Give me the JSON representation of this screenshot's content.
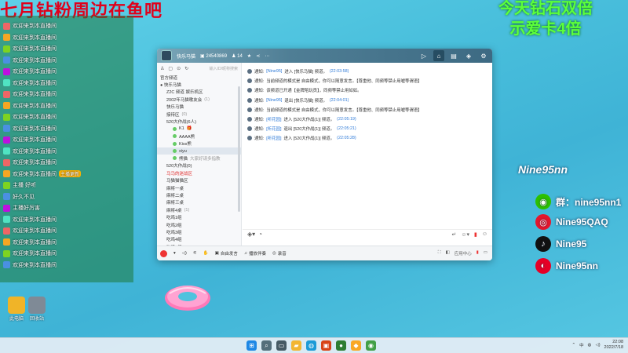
{
  "overlay": {
    "top_left_title": "七月钻粉周边在鱼吧",
    "top_right_title": "今天钻石双倍\n示爱卡4倍",
    "nine_title": "Nine95nn",
    "social": [
      {
        "icon": "wechat-icon",
        "label": "群：nine95nn1",
        "color": "#2dc100",
        "glyph": "◉"
      },
      {
        "icon": "weibo-icon",
        "label": "Nine95QAQ",
        "color": "#e6162d",
        "glyph": "◎"
      },
      {
        "icon": "tiktok-icon",
        "label": "Nine95",
        "color": "#111111",
        "glyph": "♪"
      },
      {
        "icon": "netease-music-icon",
        "label": "Nine95nn",
        "color": "#e60026",
        "glyph": "◐"
      }
    ]
  },
  "chat_overlay": {
    "lines": [
      {
        "name": "",
        "text": "欢迎来到本直播间"
      },
      {
        "name": "",
        "text": "欢迎来到本直播间"
      },
      {
        "name": "",
        "text": "欢迎来到本直播间"
      },
      {
        "name": "",
        "text": "欢迎来到本直播间"
      },
      {
        "name": "",
        "text": "欢迎来到本直播间"
      },
      {
        "name": "",
        "text": "欢迎来到本直播间"
      },
      {
        "name": "",
        "text": "欢迎来到本直播间"
      },
      {
        "name": "",
        "text": "欢迎来到本直播间"
      },
      {
        "name": "",
        "text": "欢迎来到本直播间"
      },
      {
        "name": "",
        "text": "欢迎来到本直播间"
      },
      {
        "name": "",
        "text": "欢迎来到本直播间"
      },
      {
        "name": "",
        "text": "欢迎来到本直播间"
      },
      {
        "name": "",
        "text": "欢迎来到本直播间"
      },
      {
        "name": "",
        "text": "欢迎来到本直播间"
      },
      {
        "name": "",
        "text": "主播 好听"
      },
      {
        "name": "",
        "text": "好久不见"
      },
      {
        "name": "",
        "text": "主播好厉害"
      },
      {
        "name": "",
        "text": "欢迎来到本直播间"
      },
      {
        "name": "",
        "text": "欢迎来到本直播间"
      },
      {
        "name": "",
        "text": "欢迎来到本直播间"
      },
      {
        "name": "",
        "text": "欢迎来到本直播间"
      },
      {
        "name": "",
        "text": "欢迎来到本直播间"
      }
    ],
    "gift_badge": "主播更新"
  },
  "desktop_icons": [
    {
      "label": "此电脑",
      "color": "#f0b428"
    },
    {
      "label": "回收站",
      "color": "#7f8a96"
    }
  ],
  "window": {
    "title": "快乐马猫",
    "room_id": "24540869",
    "online": "14",
    "toolbar_icons": [
      "video-icon",
      "home-icon",
      "list-icon",
      "gamepad-icon",
      "settings-icon"
    ],
    "sidebar": {
      "search_placeholder": "输入ID/昵称搜索",
      "items": [
        {
          "text": "官方频道",
          "level": 0,
          "cls": ""
        },
        {
          "text": "● 快乐马猫",
          "level": 0,
          "cls": ""
        },
        {
          "text": "Z2C 频道 娱乐机区",
          "level": 1,
          "cls": ""
        },
        {
          "text": "2002年马猫歌友会",
          "level": 1,
          "cls": "",
          "count": "(1)"
        },
        {
          "text": "快乐马猫",
          "level": 1,
          "cls": ""
        },
        {
          "text": "接待区",
          "level": 1,
          "cls": "",
          "count": "(0)"
        },
        {
          "text": "520大作战(6人)",
          "level": 1,
          "cls": ""
        },
        {
          "text": "K1",
          "level": 2,
          "cls": "",
          "badge": "🎁"
        },
        {
          "text": "AAAA熊",
          "level": 2,
          "cls": ""
        },
        {
          "text": "Kiss熊",
          "level": 2,
          "cls": ""
        },
        {
          "text": "xiyu",
          "level": 2,
          "cls": "sel"
        },
        {
          "text": "熊猫",
          "level": 2,
          "cls": "",
          "note": "大家好请多指教"
        },
        {
          "text": "520大作战(0)",
          "level": 1,
          "cls": ""
        },
        {
          "text": "马马的迷战区",
          "level": 1,
          "cls": "red"
        },
        {
          "text": "马猫猫猫区",
          "level": 1,
          "cls": ""
        },
        {
          "text": "麻将一桌",
          "level": 1,
          "cls": ""
        },
        {
          "text": "麻将二桌",
          "level": 1,
          "cls": ""
        },
        {
          "text": "麻将三桌",
          "level": 1,
          "cls": ""
        },
        {
          "text": "麻将4桌",
          "level": 1,
          "cls": "",
          "count": "(1)"
        },
        {
          "text": "吃鸡1组",
          "level": 1,
          "cls": ""
        },
        {
          "text": "吃鸡2组",
          "level": 1,
          "cls": ""
        },
        {
          "text": "吃鸡3组",
          "level": 1,
          "cls": ""
        },
        {
          "text": "吃鸡4组",
          "level": 1,
          "cls": ""
        },
        {
          "text": "吃鸡5组",
          "level": 1,
          "cls": ""
        }
      ]
    },
    "messages": [
      {
        "tag": "通知:",
        "name": "[Nine95]",
        "text": "进入 [快乐马猫] 频道。",
        "time": "(22:03:58)"
      },
      {
        "tag": "通知:",
        "name": "",
        "text": "当前频道的模式是 自由模式，你可以随意发言。【尊重他、同频等禁止用嘘等谓语】",
        "time": ""
      },
      {
        "tag": "通知:",
        "name": "",
        "text": "该频道已开通【金牌陪玩员】，同频等禁止用如如。",
        "time": ""
      },
      {
        "tag": "通知:",
        "name": "[Nine95]",
        "text": "退出 [快乐马猫] 频道。",
        "time": "(22:04:01)"
      },
      {
        "tag": "通知:",
        "name": "",
        "text": "当前频道的模式是 自由模式，你可以随意发言。【尊重他、同频等禁止用嘘等谓语】",
        "time": ""
      },
      {
        "tag": "通知:",
        "name": "[听花园]",
        "text": "进入 [520大作战(1)] 频道。",
        "time": "(22:05:19)"
      },
      {
        "tag": "通知:",
        "name": "[听花园]",
        "text": "退出 [520大作战(1)] 频道。",
        "time": "(22:05:21)"
      },
      {
        "tag": "通知:",
        "name": "[听花园]",
        "text": "进入 [520大作战(1)] 频道。",
        "time": "(22:05:28)"
      }
    ],
    "bottom": {
      "mic_mode": "自由发言",
      "music": "播放伴奏",
      "effect": "录音",
      "right1": "应用中心"
    }
  },
  "taskbar": {
    "apps": [
      {
        "icon": "windows-start-icon",
        "color": "#1e88e5",
        "glyph": "⊞"
      },
      {
        "icon": "search-icon",
        "color": "#546e7a",
        "glyph": "⌕"
      },
      {
        "icon": "task-view-icon",
        "color": "#455a64",
        "glyph": "▭"
      },
      {
        "icon": "file-explorer-icon",
        "color": "#f2b632",
        "glyph": "▰"
      },
      {
        "icon": "edge-icon",
        "color": "#1c9bd7",
        "glyph": "◍"
      },
      {
        "icon": "app-red-icon",
        "color": "#d84315",
        "glyph": "▣"
      },
      {
        "icon": "app-green-icon",
        "color": "#2e7d32",
        "glyph": "●"
      },
      {
        "icon": "app-yellow-icon",
        "color": "#f9a825",
        "glyph": "◆"
      },
      {
        "icon": "app-chrome-icon",
        "color": "#43a047",
        "glyph": "◉"
      }
    ],
    "lang": "中",
    "time": "22:08",
    "date": "2022/7/18"
  }
}
